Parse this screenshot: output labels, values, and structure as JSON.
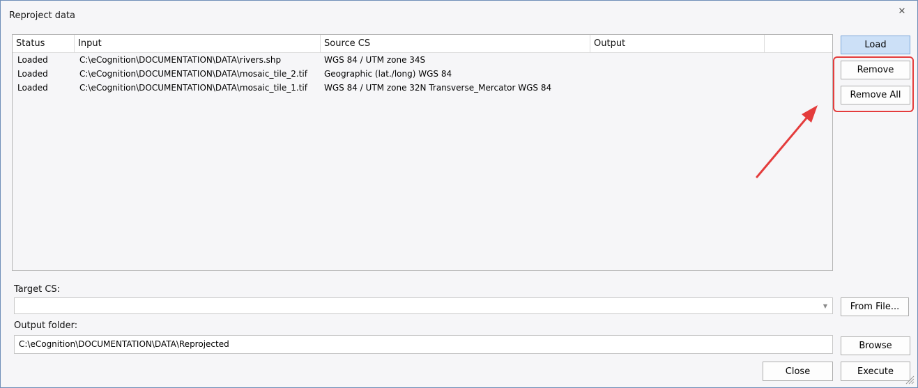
{
  "window": {
    "title": "Reproject data"
  },
  "grid": {
    "columns": [
      "Status",
      "Input",
      "Source CS",
      "Output"
    ],
    "rows": [
      {
        "status": "Loaded",
        "input": "C:\\eCognition\\DOCUMENTATION\\DATA\\rivers.shp",
        "source_cs": "WGS 84 / UTM zone 34S",
        "output": ""
      },
      {
        "status": "Loaded",
        "input": "C:\\eCognition\\DOCUMENTATION\\DATA\\mosaic_tile_2.tif",
        "source_cs": "Geographic (lat./long) WGS 84",
        "output": ""
      },
      {
        "status": "Loaded",
        "input": "C:\\eCognition\\DOCUMENTATION\\DATA\\mosaic_tile_1.tif",
        "source_cs": "WGS 84 / UTM zone 32N Transverse_Mercator WGS 84",
        "output": ""
      }
    ]
  },
  "side_buttons": {
    "load": "Load",
    "remove": "Remove",
    "remove_all": "Remove All"
  },
  "target_cs": {
    "label": "Target CS:",
    "value": "",
    "from_file": "From File..."
  },
  "output_folder": {
    "label": "Output folder:",
    "value": "C:\\eCognition\\DOCUMENTATION\\DATA\\Reprojected",
    "browse": "Browse"
  },
  "footer": {
    "close": "Close",
    "execute": "Execute"
  },
  "colors": {
    "annotation": "#e43c3c",
    "primary_button": "#cce0f7"
  },
  "icons": {
    "close": "close-icon",
    "dropdown": "chevron-down-icon",
    "resize": "resize-grip-icon"
  }
}
